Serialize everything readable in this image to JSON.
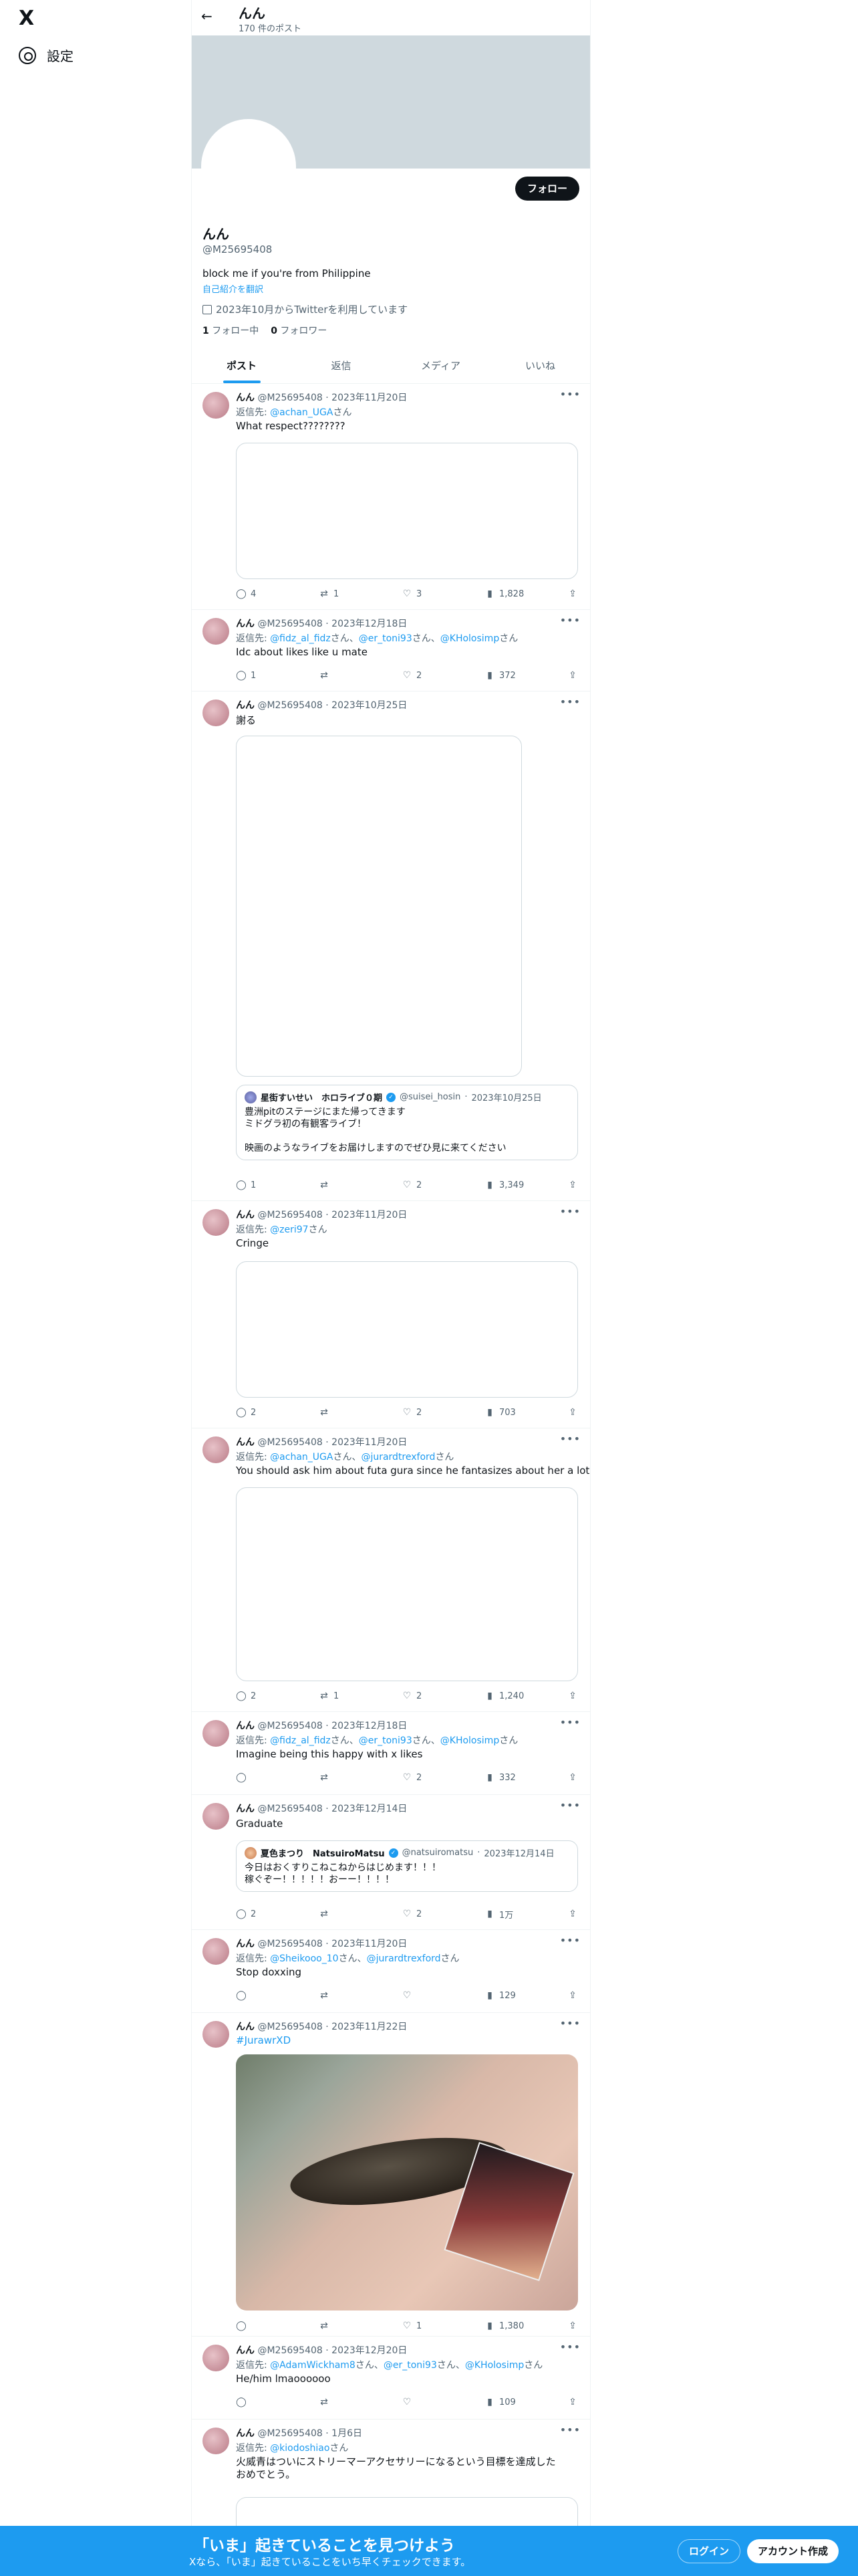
{
  "nav": {
    "logo": "X",
    "settings_label": "設定"
  },
  "topbar": {
    "back_icon": "←",
    "name": "んん",
    "post_count": "170 件のポスト"
  },
  "profile": {
    "follow_label": "フォロー",
    "name": "んん",
    "handle": "@M25695408",
    "bio": "block me if you're from Philippine",
    "translate": "自己紹介を翻訳",
    "joined": "2023年10月からTwitterを利用しています",
    "following_count": "1",
    "following_label": "フォロー中",
    "followers_count": "0",
    "followers_label": "フォロワー"
  },
  "tabs": [
    "ポスト",
    "返信",
    "メディア",
    "いいね"
  ],
  "tweets": [
    {
      "name": "んん",
      "handle": "@M25695408",
      "date": "2023年11月20日",
      "reply_prefix": "返信先: ",
      "reply_links": "@achan_UGA",
      "reply_suffix": "さん",
      "text": "What respect????????",
      "replies": "4",
      "reposts": "1",
      "likes": "3",
      "views": "1,828"
    },
    {
      "name": "んん",
      "handle": "@M25695408",
      "date": "2023年12月18日",
      "reply_prefix": "返信先: ",
      "reply_links": "@fidz_al_fidz",
      "reply_mid": "さん、",
      "reply_links2": "@er_toni93",
      "reply_mid2": "さん、",
      "reply_links3": "@KHolosimp",
      "reply_suffix": "さん",
      "text": "Idc about likes like u mate",
      "replies": "1",
      "reposts": "",
      "likes": "2",
      "views": "372"
    },
    {
      "name": "んん",
      "handle": "@M25695408",
      "date": "2023年10月25日",
      "text": "謝る",
      "replies": "1",
      "reposts": "",
      "likes": "2",
      "views": "3,349",
      "quote": {
        "name": "星街すいせい　ホロライブ０期",
        "handle": "@suisei_hosin",
        "date": "2023年10月25日",
        "text": "豊洲pitのステージにまた帰ってきます\nミドグラ初の有観客ライブ！\n\n映画のようなライブをお届けしますのでぜひ見に来てください"
      }
    },
    {
      "name": "んん",
      "handle": "@M25695408",
      "date": "2023年11月20日",
      "reply_prefix": "返信先: ",
      "reply_links": "@zeri97",
      "reply_suffix": "さん",
      "text": "Cringe",
      "replies": "2",
      "reposts": "",
      "likes": "2",
      "views": "703"
    },
    {
      "name": "んん",
      "handle": "@M25695408",
      "date": "2023年11月20日",
      "reply_prefix": "返信先: ",
      "reply_links": "@achan_UGA",
      "reply_mid": "さん、",
      "reply_links2": "@jurardtrexford",
      "reply_suffix": "さん",
      "text": "You should ask him about futa gura since he fantasizes about her a lot",
      "replies": "2",
      "reposts": "1",
      "likes": "2",
      "views": "1,240"
    },
    {
      "name": "んん",
      "handle": "@M25695408",
      "date": "2023年12月18日",
      "reply_prefix": "返信先: ",
      "reply_links": "@fidz_al_fidz",
      "reply_mid": "さん、",
      "reply_links2": "@er_toni93",
      "reply_mid2": "さん、",
      "reply_links3": "@KHolosimp",
      "reply_suffix": "さん",
      "text": "Imagine being this happy with x likes",
      "replies": "",
      "reposts": "",
      "likes": "2",
      "views": "332"
    },
    {
      "name": "んん",
      "handle": "@M25695408",
      "date": "2023年12月14日",
      "text": "Graduate",
      "replies": "2",
      "reposts": "",
      "likes": "2",
      "views": "1万",
      "quote": {
        "name": "夏色まつり　NatsuiroMatsu",
        "handle": "@natsuiromatsu",
        "date": "2023年12月14日",
        "text": "今日はおくすりこねこねからはじめます！！！\n稼ぐぞー！！！！！おーー！！！！"
      }
    },
    {
      "name": "んん",
      "handle": "@M25695408",
      "date": "2023年11月20日",
      "reply_prefix": "返信先: ",
      "reply_links": "@Sheikooo_10",
      "reply_mid": "さん、",
      "reply_links2": "@jurardtrexford",
      "reply_suffix": "さん",
      "text": "Stop doxxing",
      "replies": "",
      "reposts": "",
      "likes": "",
      "views": "129"
    },
    {
      "name": "んん",
      "handle": "@M25695408",
      "date": "2023年11月22日",
      "text": "#JurawrXD",
      "replies": "",
      "reposts": "",
      "likes": "1",
      "views": "1,380"
    },
    {
      "name": "んん",
      "handle": "@M25695408",
      "date": "2023年12月20日",
      "reply_prefix": "返信先: ",
      "reply_links": "@AdamWickham8",
      "reply_mid": "さん、",
      "reply_links2": "@er_toni93",
      "reply_mid2": "さん、",
      "reply_links3": "@KHolosimp",
      "reply_suffix": "さん",
      "text": "He/him lmaoooooo",
      "replies": "",
      "reposts": "",
      "likes": "",
      "views": "109"
    },
    {
      "name": "んん",
      "handle": "@M25695408",
      "date": "1月6日",
      "reply_prefix": "返信先: ",
      "reply_links": "@kiodoshiao",
      "reply_suffix": "さん",
      "text": "火威青はついにストリーマーアクセサリーになるという目標を達成した\nおめでとう。"
    }
  ],
  "bottom_bar": {
    "title": "「いま」起きていることを見つけよう",
    "subtitle": "Xなら、「いま」起きていることをいち早くチェックできます。",
    "login": "ログイン",
    "signup": "アカウント作成"
  },
  "icons": {
    "reply": "reply-icon",
    "repost": "repost-icon",
    "like": "heart-icon",
    "views": "views-icon",
    "share": "share-icon"
  },
  "colors": {
    "accent": "#1d9bf0",
    "text": "#0f1419",
    "muted": "#536471"
  }
}
